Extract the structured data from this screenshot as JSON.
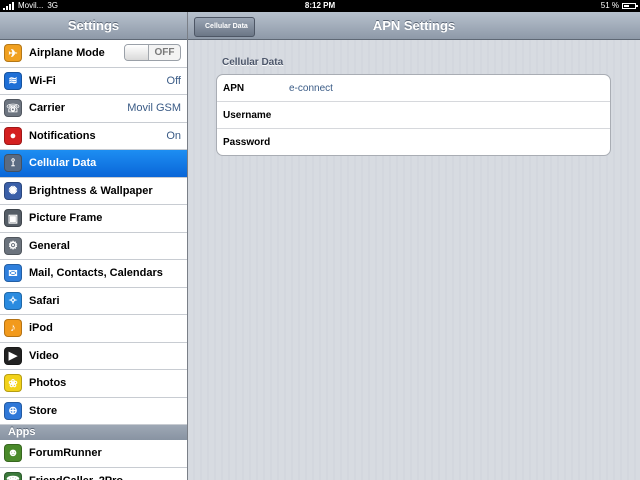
{
  "status_bar": {
    "carrier": "Movil...",
    "network": "3G",
    "time": "8:12 PM",
    "battery": "51 %",
    "battery_level": 0.51
  },
  "sidebar": {
    "title": "Settings",
    "items": [
      {
        "label": "Airplane Mode",
        "icon": "airplane-icon",
        "color": "#f0a020",
        "glyph": "✈",
        "toggle": "OFF"
      },
      {
        "label": "Wi-Fi",
        "icon": "wifi-icon",
        "color": "#1e6fd6",
        "glyph": "≋",
        "value": "Off"
      },
      {
        "label": "Carrier",
        "icon": "phone-icon",
        "color": "#6d7580",
        "glyph": "☏",
        "value": "Movil GSM"
      },
      {
        "label": "Notifications",
        "icon": "notifications-icon",
        "color": "#d42020",
        "glyph": "●",
        "value": "On"
      },
      {
        "label": "Cellular Data",
        "icon": "cellular-icon",
        "color": "#5a6b82",
        "glyph": "⟟",
        "selected": true
      },
      {
        "label": "Brightness & Wallpaper",
        "icon": "brightness-icon",
        "color": "#3a5fa8",
        "glyph": "✺"
      },
      {
        "label": "Picture Frame",
        "icon": "picture-frame-icon",
        "color": "#555d66",
        "glyph": "▣"
      },
      {
        "label": "General",
        "icon": "gear-icon",
        "color": "#6b737d",
        "glyph": "⚙"
      },
      {
        "label": "Mail, Contacts, Calendars",
        "icon": "mail-icon",
        "color": "#2f7fdc",
        "glyph": "✉"
      },
      {
        "label": "Safari",
        "icon": "safari-icon",
        "color": "#2a8be0",
        "glyph": "✧"
      },
      {
        "label": "iPod",
        "icon": "ipod-icon",
        "color": "#f29a1c",
        "glyph": "♪"
      },
      {
        "label": "Video",
        "icon": "video-icon",
        "color": "#222222",
        "glyph": "▶"
      },
      {
        "label": "Photos",
        "icon": "photos-icon",
        "color": "#f2d21a",
        "glyph": "❀"
      },
      {
        "label": "Store",
        "icon": "store-icon",
        "color": "#2f78d8",
        "glyph": "⊕"
      }
    ],
    "apps_header": "Apps",
    "apps": [
      {
        "label": "ForumRunner",
        "icon": "forumrunner-icon",
        "color": "#4a8a2a",
        "glyph": "☻"
      },
      {
        "label": "FriendCaller, 2Pro",
        "icon": "friendcaller-icon",
        "color": "#3b7a3b",
        "glyph": "☎"
      }
    ]
  },
  "main": {
    "back_label": "Cellular Data",
    "title": "APN Settings",
    "group_title": "Cellular Data",
    "fields": [
      {
        "label": "APN",
        "value": "e-connect"
      },
      {
        "label": "Username",
        "value": ""
      },
      {
        "label": "Password",
        "value": ""
      }
    ]
  }
}
